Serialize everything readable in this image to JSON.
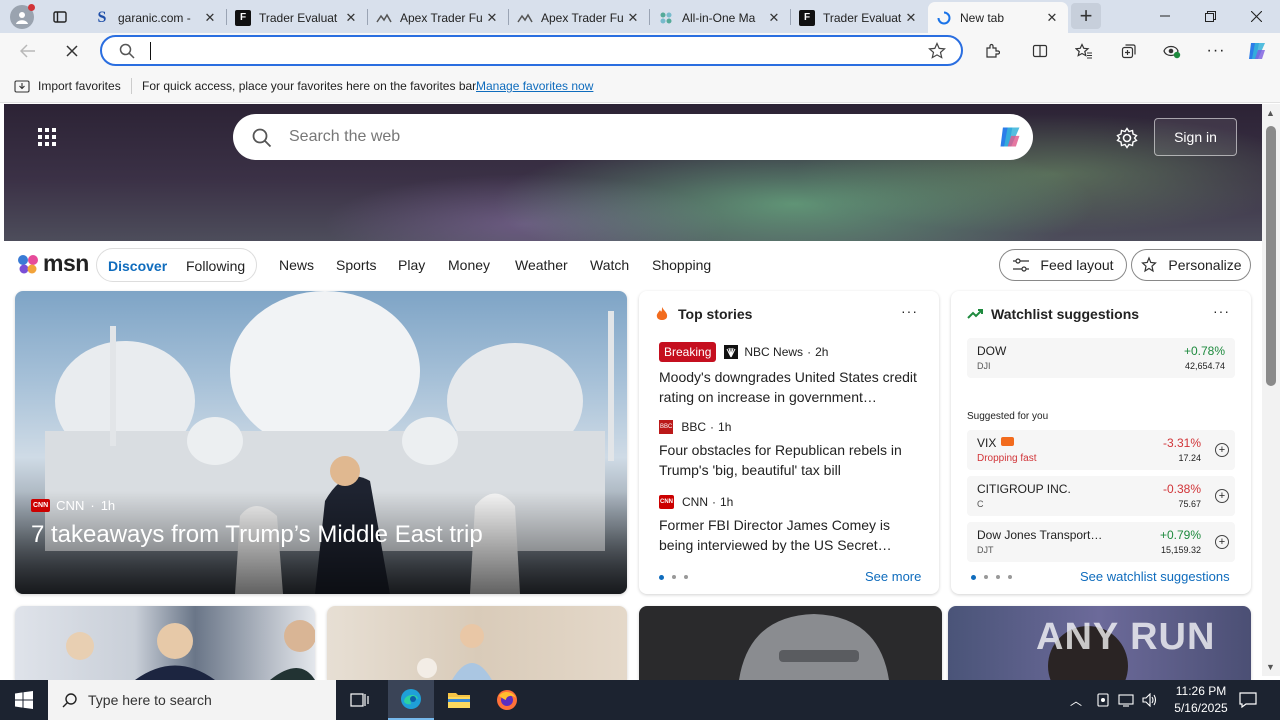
{
  "tabs": [
    {
      "label": "garanic.com -",
      "icon": "s-icon"
    },
    {
      "label": "Trader Evaluat",
      "icon": "trader-icon"
    },
    {
      "label": "Apex Trader Fu",
      "icon": "apex-icon"
    },
    {
      "label": "Apex Trader Fu",
      "icon": "apex-icon"
    },
    {
      "label": "All-in-One Ma",
      "icon": "aio-icon"
    },
    {
      "label": "Trader Evaluat",
      "icon": "trader-icon"
    },
    {
      "label": "New tab",
      "icon": "loading-icon"
    }
  ],
  "address": {
    "value": ""
  },
  "favorites_bar": {
    "import": "Import favorites",
    "hint": "For quick access, place your favorites here on the favorites bar.",
    "manage": "Manage favorites now"
  },
  "hero": {
    "search_placeholder": "Search the web",
    "signin": "Sign in"
  },
  "msn": {
    "logo": "msn",
    "pills": [
      "Discover",
      "Following"
    ],
    "nav": [
      "News",
      "Sports",
      "Play",
      "Money",
      "Weather",
      "Watch",
      "Shopping"
    ],
    "feed_layout": "Feed layout",
    "personalize": "Personalize"
  },
  "main_story": {
    "source": "CNN",
    "source_logo": "CNN",
    "time": "1h",
    "headline": "7 takeaways from Trump’s Middle East trip"
  },
  "top_stories": {
    "title": "Top stories",
    "items": [
      {
        "badge": "Breaking",
        "source": "NBC News",
        "time": "2h",
        "headline": "Moody's downgrades United States credit rating on increase in government…"
      },
      {
        "source": "BBC",
        "source_logo": "BBC",
        "time": "1h",
        "headline": "Four obstacles for Republican rebels in Trump's 'big, beautiful' tax bill"
      },
      {
        "source": "CNN",
        "source_logo": "CNN",
        "time": "1h",
        "headline": "Former FBI Director James Comey is being interviewed by the US Secret…"
      }
    ],
    "see_more": "See more"
  },
  "watchlist": {
    "title": "Watchlist suggestions",
    "dow": {
      "name": "DOW",
      "ticker": "DJI",
      "change": "+0.78%",
      "value": "42,654.74"
    },
    "suggested_label": "Suggested for you",
    "items": [
      {
        "name": "VIX",
        "sub": "Dropping fast",
        "change": "-3.31%",
        "value": "17.24"
      },
      {
        "name": "CITIGROUP INC.",
        "sub": "C",
        "change": "-0.38%",
        "value": "75.67"
      },
      {
        "name": "Dow Jones Transport…",
        "sub": "DJT",
        "change": "+0.79%",
        "value": "15,159.32"
      }
    ],
    "see_link": "See watchlist suggestions"
  },
  "watermark": "ANY RUN",
  "taskbar": {
    "search_placeholder": "Type here to search",
    "time": "11:26 PM",
    "date": "5/16/2025"
  },
  "colors": {
    "accent": "#0f6cbd",
    "breaking": "#c50f1f",
    "positive": "#1e8a3e",
    "negative": "#d13438"
  }
}
